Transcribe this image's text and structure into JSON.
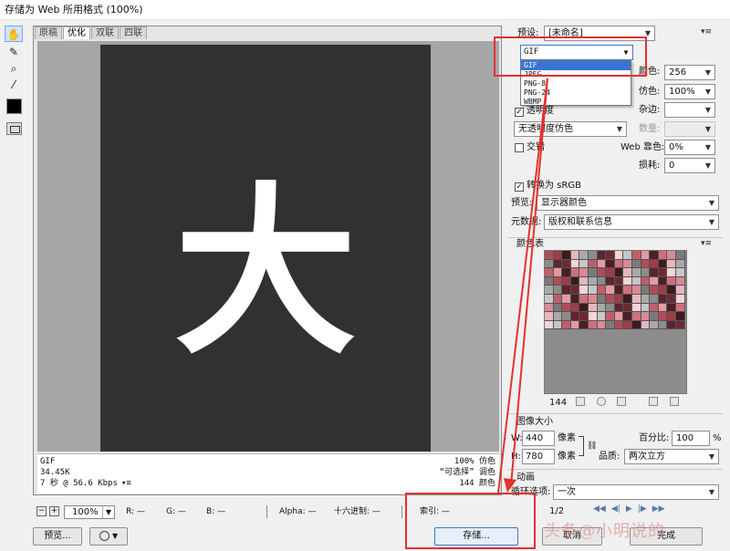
{
  "window": {
    "title": "存储为 Web 所用格式 (100%)"
  },
  "tools": {
    "hand": "✋",
    "slice": "✎",
    "zoom": "⌕",
    "eyedropper": "⁄"
  },
  "tabs": [
    "原稿",
    "优化",
    "双联",
    "四联"
  ],
  "preview": {
    "text": "大",
    "info_left": [
      "GIF",
      "34.45K",
      "7 秒 @ 56.6 Kbps"
    ],
    "info_left_menu": "▾≡",
    "info_right": [
      "100% 仿色",
      "“可选择” 调色",
      "144 颜色"
    ]
  },
  "status": {
    "zoom": "100%",
    "r": "R: —",
    "g": "G: —",
    "b": "B: —",
    "alpha": "Alpha: —",
    "hex": "十六进制: —",
    "index": "索引: —"
  },
  "buttons": {
    "preview": "预览...",
    "save": "存储...",
    "cancel": "取消",
    "done": "完成"
  },
  "settings": {
    "preset_label": "预设:",
    "preset_value": "[未命名]",
    "format_value": "GIF",
    "format_options": [
      "GIF",
      "JPEG",
      "PNG-8",
      "PNG-24",
      "WBMP"
    ],
    "colors_label": "颜色:",
    "colors_value": "256",
    "dither_label": "仿色:",
    "dither_value": "100%",
    "matte_label": "杂边:",
    "transparency_label": "透明度",
    "transparency_dither": "无透明度仿色",
    "amount_label": "数量:",
    "interlaced_label": "交错",
    "web_snap_label": "Web 靠色:",
    "web_snap_value": "0%",
    "lossy_label": "损耗:",
    "lossy_value": "0",
    "convert_srgb_label": "转换为 sRGB",
    "preview_label": "预览:",
    "preview_value": "显示器颜色",
    "metadata_label": "元数据:",
    "metadata_value": "版权和联系信息"
  },
  "color_table": {
    "title": "颜色表",
    "count": "144"
  },
  "image_size": {
    "title": "图像大小",
    "w_label": "W:",
    "w_value": "440",
    "h_label": "H:",
    "h_value": "780",
    "unit": "像素",
    "percent_label": "百分比:",
    "percent_value": "100",
    "percent_unit": "%",
    "quality_label": "品质:",
    "quality_value": "两次立方"
  },
  "animation": {
    "title": "动画",
    "loop_label": "循环选项:",
    "loop_value": "一次",
    "frame": "1/2"
  },
  "watermark": "头条@小明说的",
  "palette": [
    "#b04c5a",
    "#6b2a34",
    "#d98a94",
    "#8c8c8c",
    "#4a1f26",
    "#e6b7bd",
    "#c25d6b",
    "#9e3c49",
    "#f2d5d8",
    "#7a7a7a",
    "#5c2530",
    "#d0707d",
    "#a9a9a9",
    "#e39aa3",
    "#3b1a20",
    "#c7c7c7"
  ],
  "colors": {
    "accent": "#3875d7",
    "annotation": "#e53030"
  }
}
